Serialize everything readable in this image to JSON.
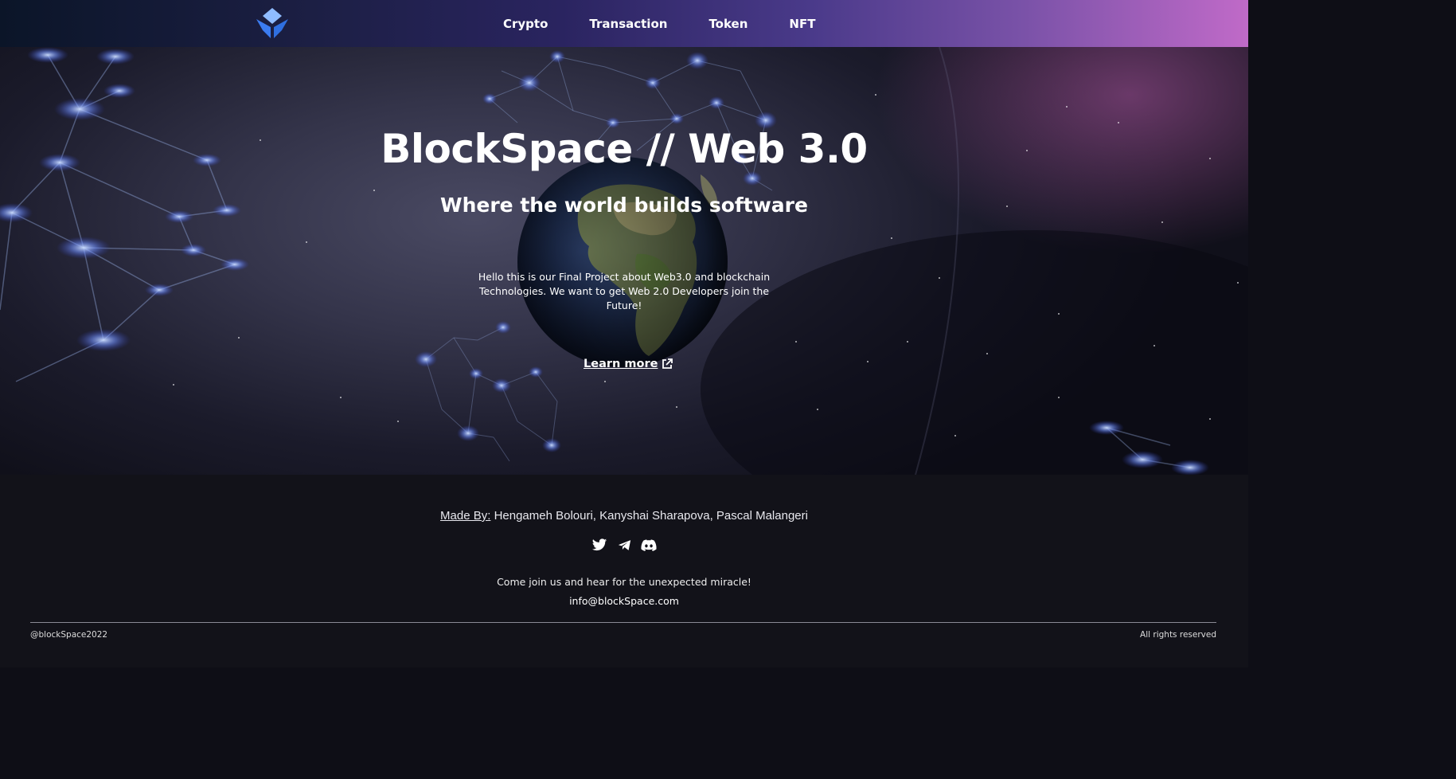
{
  "nav": {
    "logo_icon": "blockchain-cube-logo",
    "links": [
      "Crypto",
      "Transaction",
      "Token",
      "NFT"
    ]
  },
  "hero": {
    "title": "BlockSpace // Web 3.0",
    "subtitle": "Where the world builds software",
    "description": "Hello this is our Final Project about Web3.0 and blockchain Technologies. We want to get Web 2.0 Developers join the Future!",
    "cta_label": "Learn more",
    "cta_icon": "external-link-icon"
  },
  "footer": {
    "made_by_label": "Made By:",
    "made_by_names": "Hengameh Bolouri, Kanyshai Sharapova, Pascal Malangeri",
    "social_icons": [
      "twitter-icon",
      "telegram-icon",
      "discord-icon"
    ],
    "tagline": "Come join us and hear for the unexpected miracle!",
    "email": "info@blockSpace.com",
    "handle": "@blockSpace2022",
    "rights": "All rights reserved"
  },
  "colors": {
    "nav_gradient_start": "#0b1528",
    "nav_gradient_end": "#c06ac8",
    "logo_light": "#6aa8ff",
    "logo_dark": "#2f6fe0",
    "footer_bg": "#121219"
  }
}
